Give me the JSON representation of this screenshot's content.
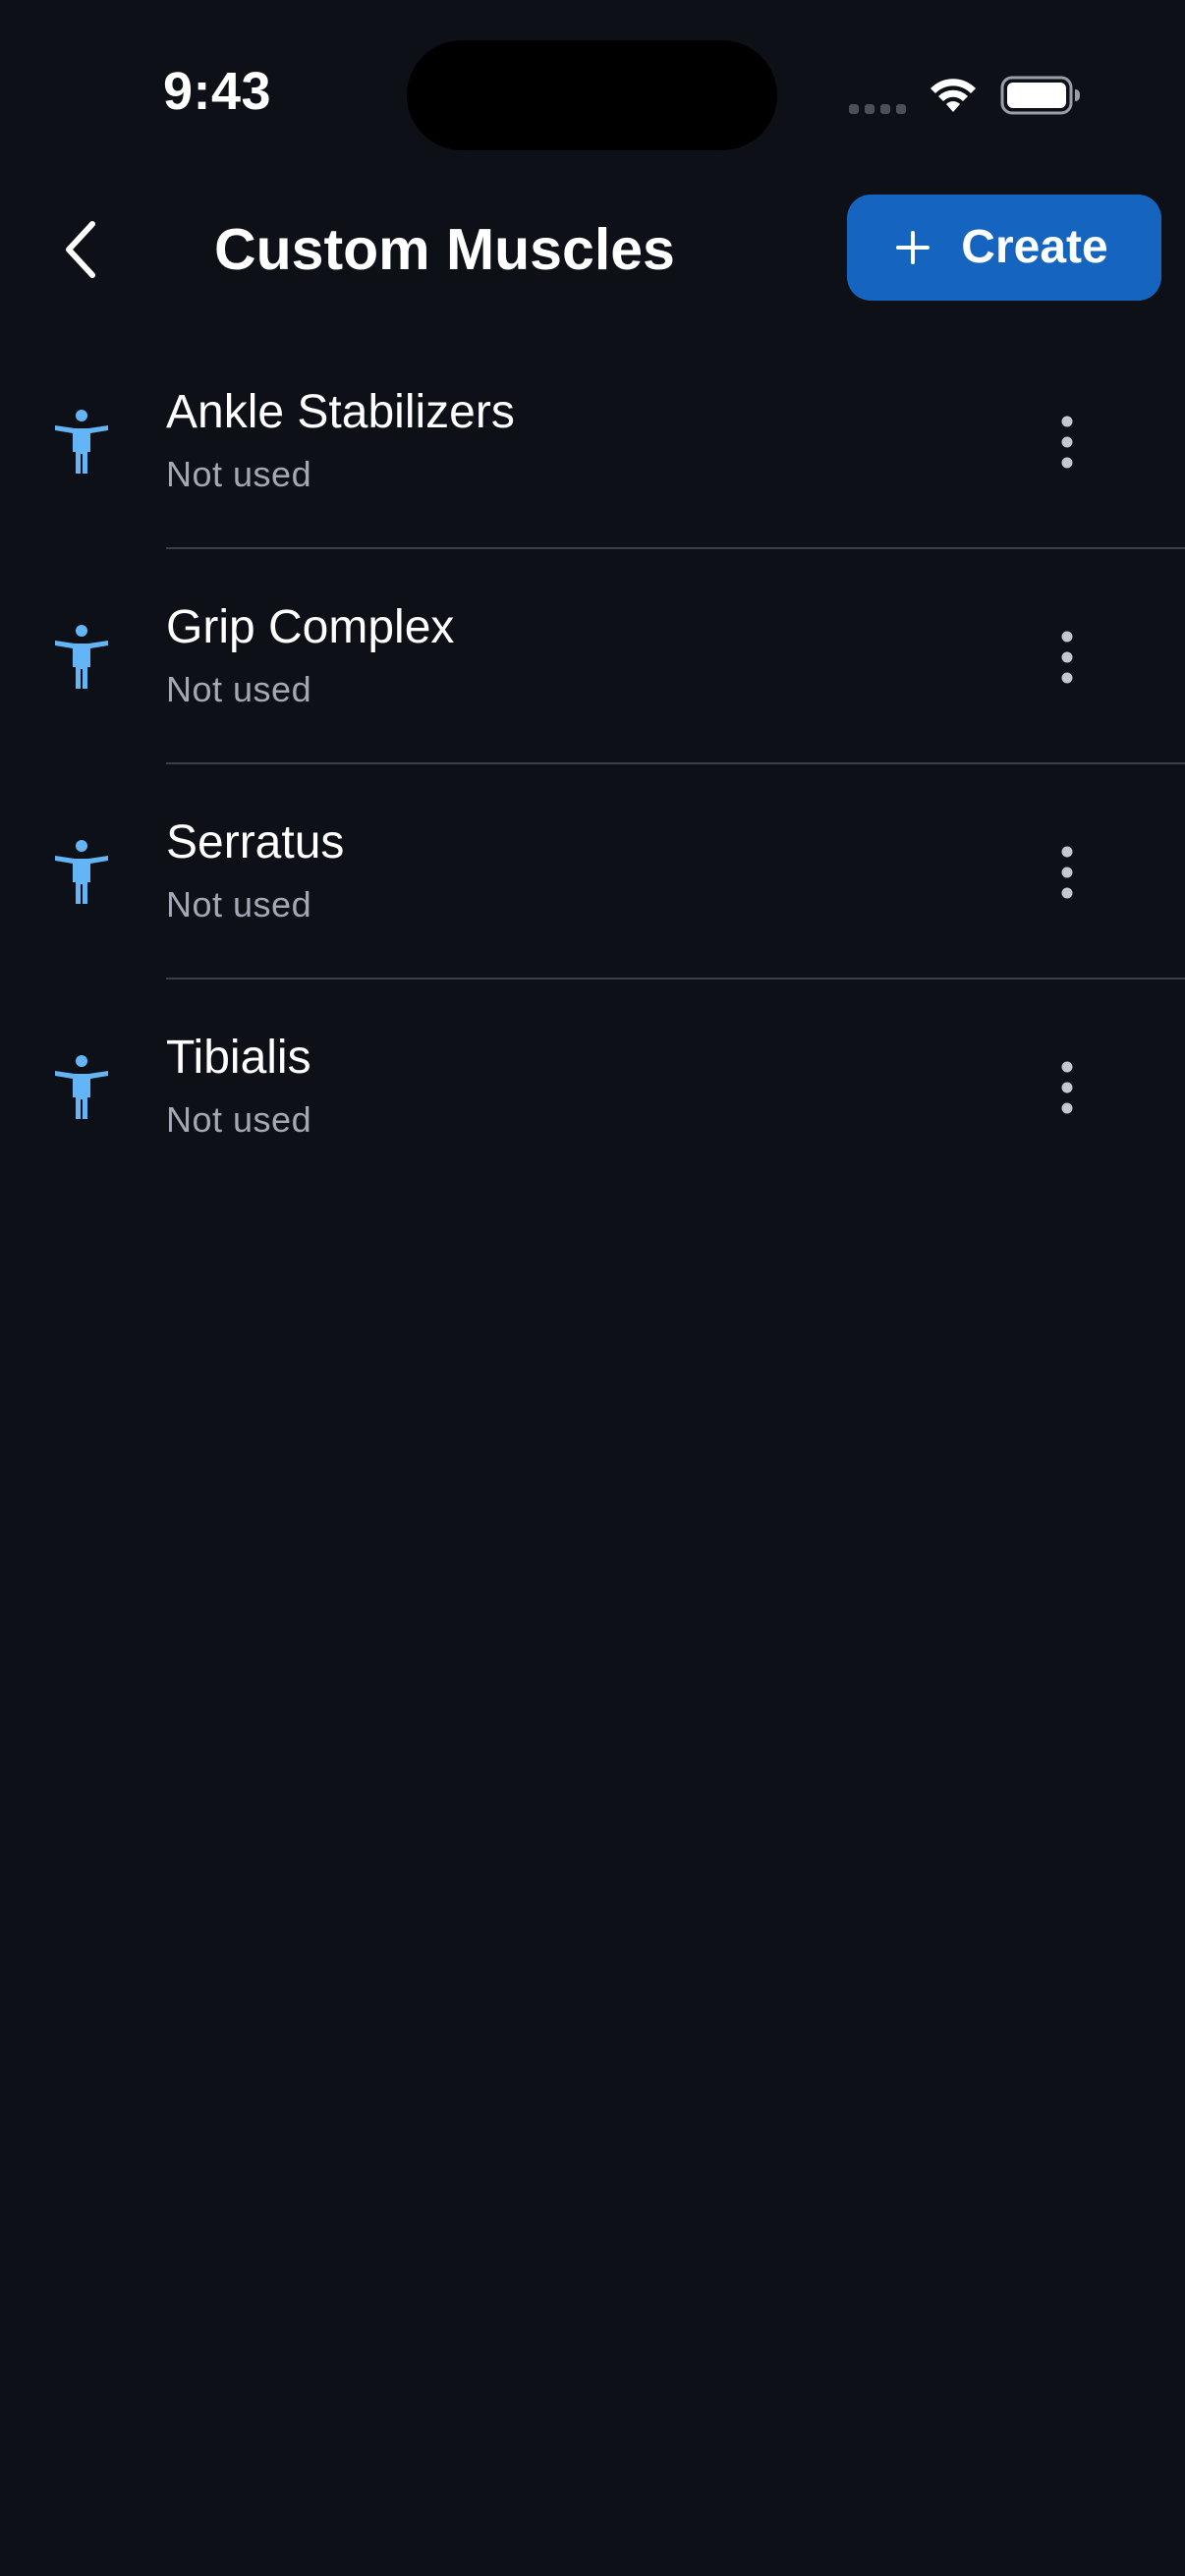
{
  "status_bar": {
    "time": "9:43"
  },
  "header": {
    "title": "Custom Muscles",
    "back_icon": "chevron-left-icon",
    "create_label": "Create",
    "create_icon": "plus-icon"
  },
  "colors": {
    "background": "#0d1017",
    "accent": "#1565c0",
    "icon_blue": "#64b5f6",
    "subtitle": "#a4a8b2",
    "divider": "#3b3f46"
  },
  "muscles": [
    {
      "name": "Ankle Stabilizers",
      "usage": "Not used",
      "icon": "person-accessibility-icon"
    },
    {
      "name": "Grip Complex",
      "usage": "Not used",
      "icon": "person-accessibility-icon"
    },
    {
      "name": "Serratus",
      "usage": "Not used",
      "icon": "person-accessibility-icon"
    },
    {
      "name": "Tibialis",
      "usage": "Not used",
      "icon": "person-accessibility-icon"
    }
  ]
}
